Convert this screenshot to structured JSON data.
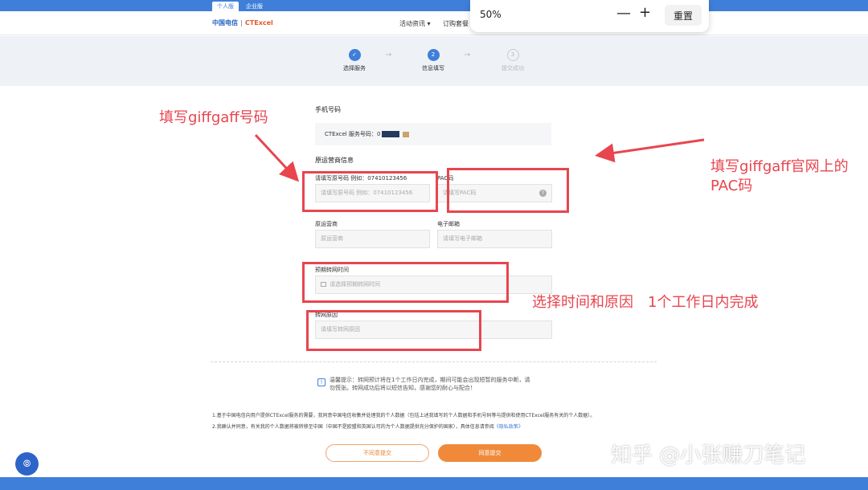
{
  "top_tabs": [
    "个人版",
    "企业版"
  ],
  "header": {
    "logo_ct": "中国电信",
    "logo_sep": "|",
    "logo_cte": "CTExcel",
    "nav": [
      "活动资讯 ▾",
      "订购套餐 ▾"
    ]
  },
  "zoom": {
    "percent": "50%",
    "minus": "—",
    "plus": "+",
    "reset": "重置"
  },
  "steps": [
    {
      "icon": "✓",
      "label": "选择服务"
    },
    {
      "icon": "2",
      "label": "信息填写"
    },
    {
      "icon": "3",
      "label": "提交成功"
    }
  ],
  "step_arrow": "→",
  "form": {
    "phone_title": "手机号码",
    "number_prefix": "CTExcel 服务号码：",
    "number_partial": "0",
    "carrier_title": "原运营商信息",
    "original_number_label": "请填写原号码 例如：07410123456",
    "original_number_placeholder": "请填写原号码 例如：07410123456",
    "pac_label": "PAC码",
    "pac_placeholder": "请填写PAC码",
    "pac_help": "?",
    "carrier_label": "原运营商",
    "carrier_placeholder": "原运营商",
    "email_label": "电子邮箱",
    "email_placeholder": "请填写电子邮箱",
    "time_label": "预期转网时间",
    "time_placeholder": "请选择预期转网时间",
    "reason_label": "转网原因",
    "reason_placeholder": "请填写转网原因"
  },
  "tip": {
    "icon": "!",
    "text": "温馨提示：转网预计将在1个工作日内完成，期间可能会出现短暂的服务中断，请勿慌张。转网成功后将以短信告知，感谢您的耐心与配合！"
  },
  "notes": {
    "line1": "1.基于中国电信向用户提供CTExcel服务的需要，我同意中国电信收集并处理我的个人数据（包括上述我填写的个人数据和手机号码等与提供和使用CTExcel服务有关的个人数据）。",
    "line2": "2.我确认并同意，有关我的个人数据将被转移至中国（中国不是欧盟和英国认可的为个人数据提供充分保护的国家），具体信息请参阅",
    "link": "《隐私政策》"
  },
  "buttons": {
    "disagree": "不同意提交",
    "agree": "同意提交"
  },
  "fab_icon": "⦾",
  "annotations": {
    "giffgaff_number": "填写giffgaff号码",
    "pac_line1": "填写giffgaff官网上的",
    "pac_line2": "PAC码",
    "time_reason": "选择时间和原因　1个工作日内完成"
  },
  "watermark": "知乎 @小张赚刀笔记",
  "colors": {
    "brand_blue": "#3f7fd9",
    "accent_orange": "#f08a3a",
    "annotation_red": "#e8454f"
  }
}
